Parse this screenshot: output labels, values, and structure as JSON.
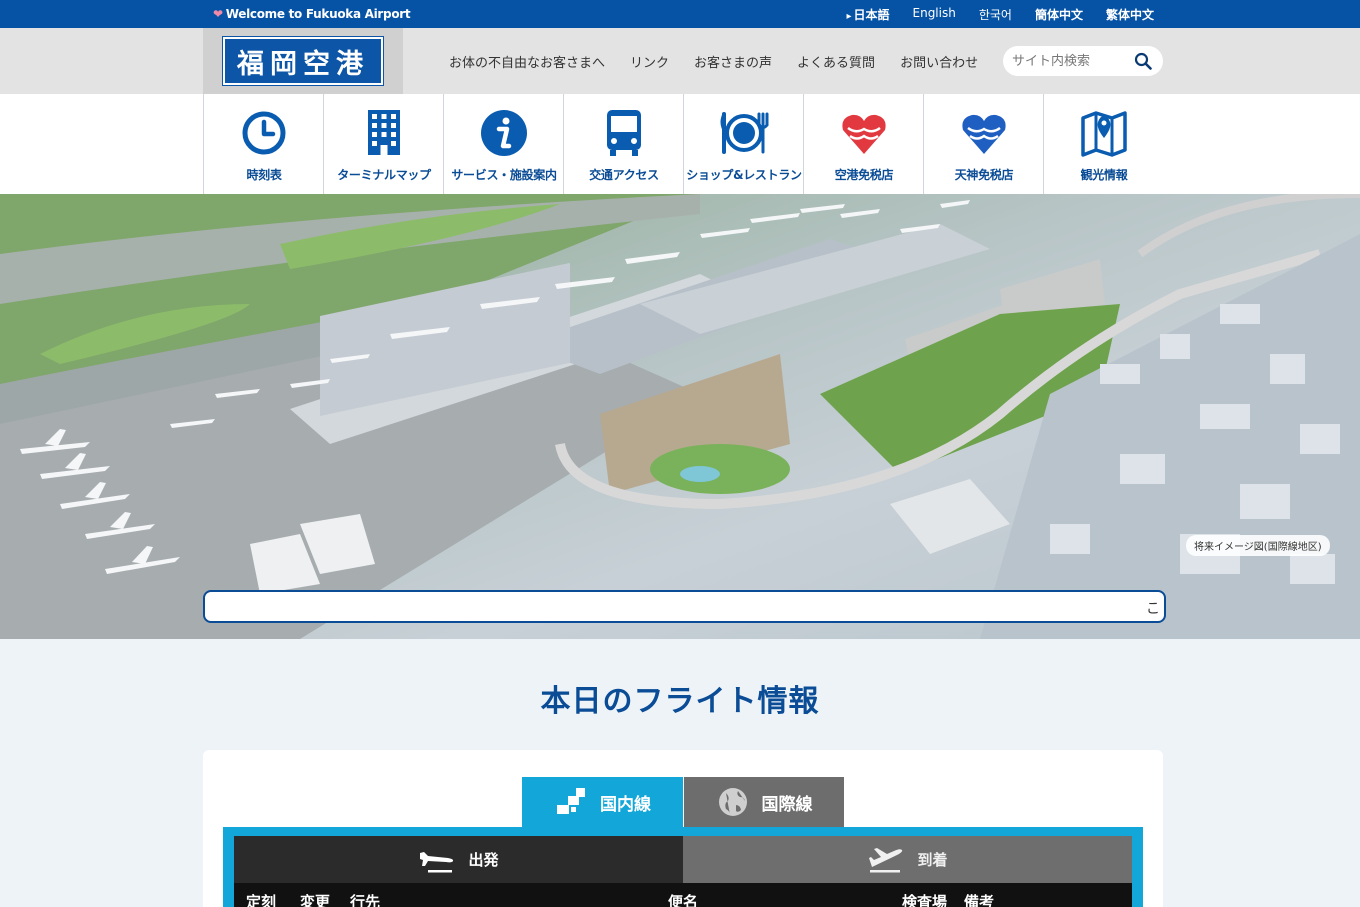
{
  "topbar": {
    "welcome": "Welcome to Fukuoka Airport",
    "languages": [
      "日本語",
      "English",
      "한국어",
      "簡体中文",
      "繁体中文"
    ]
  },
  "header": {
    "logo": "福岡空港",
    "util_links": [
      "お体の不自由なお客さまへ",
      "リンク",
      "お客さまの声",
      "よくある質問",
      "お問い合わせ"
    ],
    "search_placeholder": "サイト内検索"
  },
  "mainnav": {
    "items": [
      {
        "label": "時刻表",
        "icon": "clock-icon"
      },
      {
        "label": "ターミナルマップ",
        "icon": "building-icon"
      },
      {
        "label": "サービス・施設案内",
        "icon": "info-icon"
      },
      {
        "label": "交通アクセス",
        "icon": "bus-icon"
      },
      {
        "label": "ショップ&レストラン",
        "icon": "dining-icon"
      },
      {
        "label": "空港免税店",
        "icon": "heart-shield-icon"
      },
      {
        "label": "天神免税店",
        "icon": "heart-shield-blue-icon"
      },
      {
        "label": "観光情報",
        "icon": "map-pin-icon"
      }
    ]
  },
  "hero": {
    "caption": "将来イメージ図(国際線地区)",
    "notice_text": "こ"
  },
  "flights": {
    "title": "本日のフライト情報",
    "tabs": [
      "国内線",
      "国際線"
    ],
    "direction_tabs": [
      "出発",
      "到着"
    ],
    "columns": [
      "定刻",
      "変更",
      "行先",
      "便名",
      "検査場",
      "備考"
    ]
  },
  "colors": {
    "brand_blue": "#0653a6",
    "accent_cyan": "#13a7d9",
    "duty_free_red": "#e2383f"
  }
}
